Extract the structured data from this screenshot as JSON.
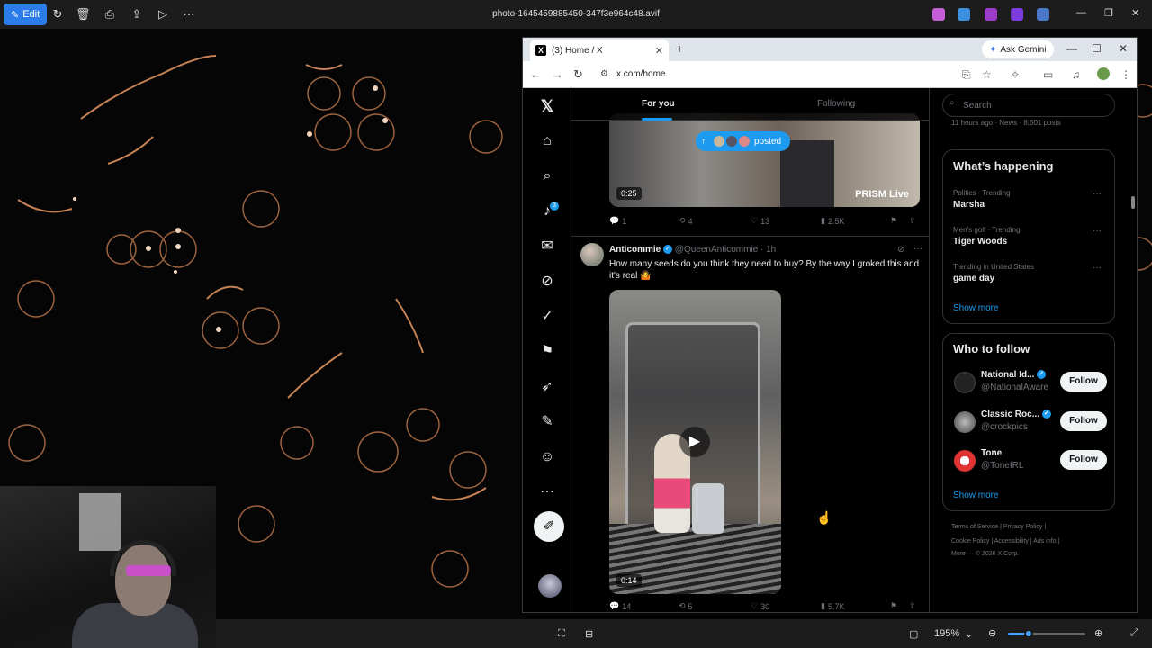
{
  "viewer": {
    "edit_label": "Edit",
    "file_name": "photo-1645459885450-347f3e964c48.avif",
    "zoom_level": "195%",
    "zoom_fraction": 0.25
  },
  "browser": {
    "tab_title": "(3) Home / X",
    "gemini_label": "Ask Gemini",
    "url": "x.com/home"
  },
  "x": {
    "tabs": {
      "for_you": "For you",
      "following": "Following"
    },
    "notification_count": "3",
    "posted_pill": "posted",
    "video1": {
      "duration": "0:25",
      "prism": "PRISM Live",
      "stats": {
        "replies": "1",
        "reposts": "4",
        "likes": "13",
        "views": "2.5K"
      }
    },
    "post": {
      "name": "Anticommie",
      "handle": "@QueenAnticommie · 1h",
      "text": "How many seeds do you think they need to buy? By the way I groked this and it's real 🤷",
      "duration": "0:14",
      "stats": {
        "replies": "14",
        "reposts": "5",
        "likes": "30",
        "views": "5.7K"
      }
    },
    "right": {
      "search_placeholder": "Search",
      "top_news_meta": "11 hours ago · News · 8,501 posts",
      "happening_title": "What’s happening",
      "trends": [
        {
          "meta": "Politics · Trending",
          "name": "Marsha"
        },
        {
          "meta": "Men's golf · Trending",
          "name": "Tiger Woods"
        },
        {
          "meta": "Trending in United States",
          "name": "game day"
        }
      ],
      "show_more": "Show more",
      "wtf_title": "Who to follow",
      "follow_label": "Follow",
      "accounts": [
        {
          "name": "National Id...",
          "handle": "@NationalAware"
        },
        {
          "name": "Classic Roc...",
          "handle": "@crockpics"
        },
        {
          "name": "Tone",
          "handle": "@ToneIRL"
        }
      ],
      "footer": {
        "line1": "Terms of Service  |  Privacy Policy  |",
        "line2": "Cookie Policy  |  Accessibility  |  Ads info  |",
        "line3": "More ···  © 2026 X Corp."
      }
    }
  },
  "colors": {
    "accent": "#1d9bf0",
    "edit_button": "#2b7de9",
    "x_background": "#000000"
  }
}
